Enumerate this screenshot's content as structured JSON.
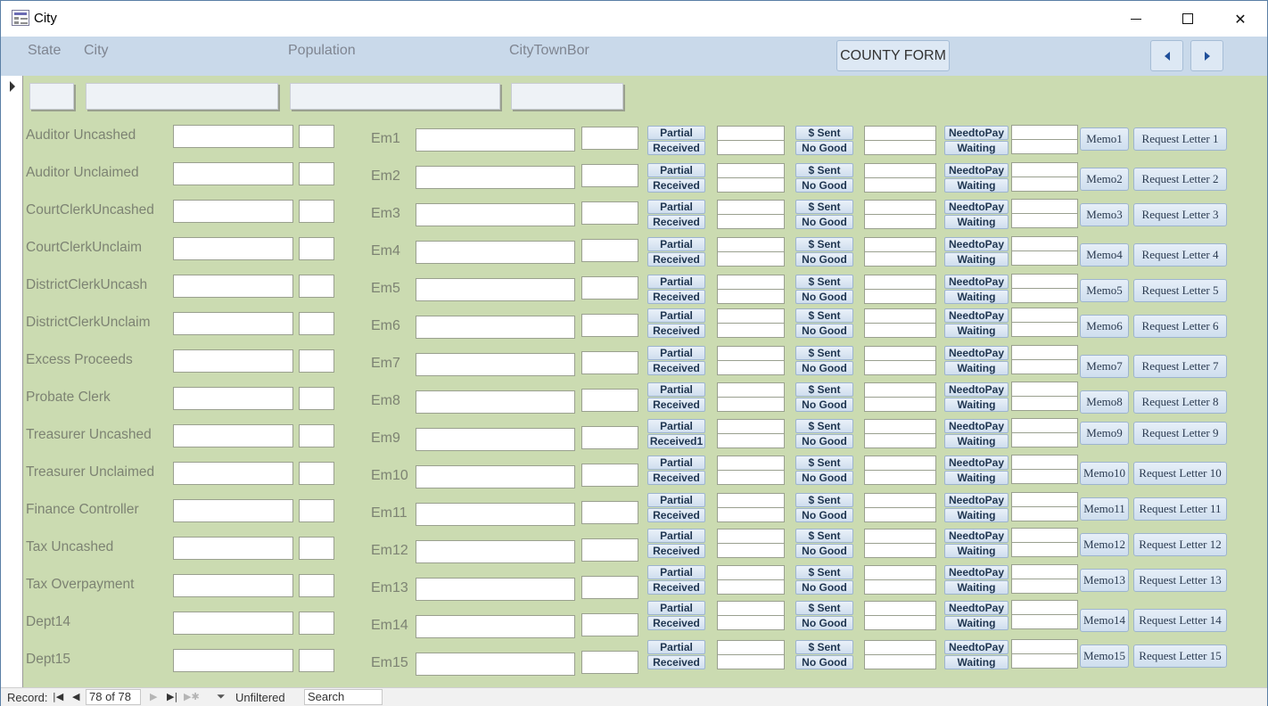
{
  "window": {
    "title": "City"
  },
  "header": {
    "labels": {
      "state": "State",
      "city": "City",
      "population": "Population",
      "city_town_bor": "CityTownBor"
    },
    "county_button": "COUNTY FORM"
  },
  "rows": [
    {
      "label": "Auditor Uncashed",
      "em": "Em1",
      "received": "Received",
      "memo": "Memo1",
      "request": "Request Letter 1"
    },
    {
      "label": "Auditor Unclaimed",
      "em": "Em2",
      "received": "Received",
      "memo": "Memo2",
      "request": "Request Letter 2"
    },
    {
      "label": "CourtClerkUncashed",
      "em": "Em3",
      "received": "Received",
      "memo": "Memo3",
      "request": "Request Letter 3"
    },
    {
      "label": "CourtClerkUnclaim",
      "em": "Em4",
      "received": "Received",
      "memo": "Memo4",
      "request": "Request Letter 4"
    },
    {
      "label": "DistrictClerkUncash",
      "em": "Em5",
      "received": "Received",
      "memo": "Memo5",
      "request": "Request Letter 5"
    },
    {
      "label": "DistrictClerkUnclaim",
      "em": "Em6",
      "received": "Received",
      "memo": "Memo6",
      "request": "Request Letter 6"
    },
    {
      "label": "Excess Proceeds",
      "em": "Em7",
      "received": "Received",
      "memo": "Memo7",
      "request": "Request Letter 7"
    },
    {
      "label": "Probate Clerk",
      "em": "Em8",
      "received": "Received",
      "memo": "Memo8",
      "request": "Request Letter 8"
    },
    {
      "label": "Treasurer Uncashed",
      "em": "Em9",
      "received": "Received1",
      "memo": "Memo9",
      "request": "Request Letter 9"
    },
    {
      "label": "Treasurer Unclaimed",
      "em": "Em10",
      "received": "Received",
      "memo": "Memo10",
      "request": "Request Letter 10"
    },
    {
      "label": "Finance Controller",
      "em": "Em11",
      "received": "Received",
      "memo": "Memo11",
      "request": "Request Letter 11"
    },
    {
      "label": "Tax Uncashed",
      "em": "Em12",
      "received": "Received",
      "memo": "Memo12",
      "request": "Request Letter 12"
    },
    {
      "label": "Tax Overpayment",
      "em": "Em13",
      "received": "Received",
      "memo": "Memo13",
      "request": "Request Letter 13"
    },
    {
      "label": "Dept14",
      "em": "Em14",
      "received": "Received",
      "memo": "Memo14",
      "request": "Request Letter 14"
    },
    {
      "label": "Dept15",
      "em": "Em15",
      "received": "Received",
      "memo": "Memo15",
      "request": "Request Letter 15"
    }
  ],
  "button_labels": {
    "partial": "Partial",
    "sent": "$ Sent",
    "no_good": "No Good",
    "need_to_pay": "NeedtoPay",
    "waiting": "Waiting"
  },
  "statusbar": {
    "record_label": "Record:",
    "record_value": "78 of 78",
    "filter": "Unfiltered",
    "search": "Search"
  }
}
